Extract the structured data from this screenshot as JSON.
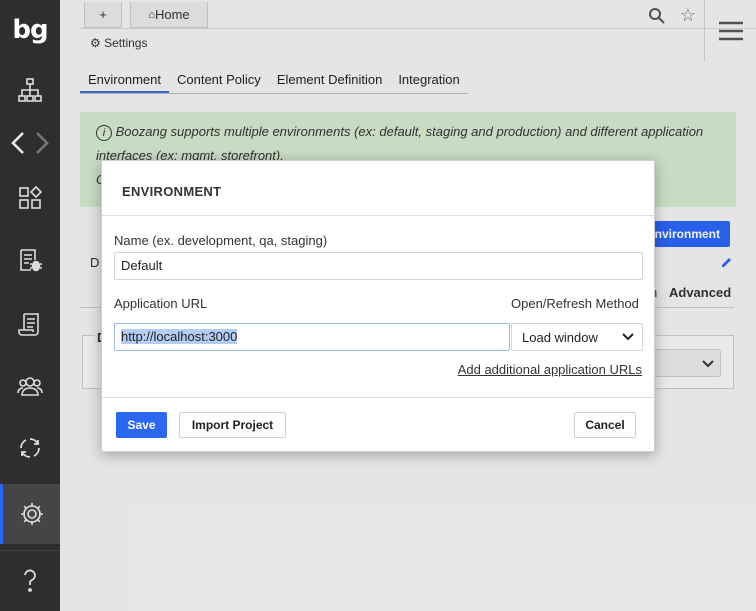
{
  "app": {
    "logo_text": "bg",
    "accent_color": "#2c66f5"
  },
  "sidebar": {
    "items": [
      {
        "icon": "sitemap-icon"
      },
      {
        "icon": "back-arrow-icon"
      },
      {
        "icon": "forward-arrow-icon"
      },
      {
        "icon": "modules-icon"
      },
      {
        "icon": "test-bug-icon"
      },
      {
        "icon": "script-icon"
      },
      {
        "icon": "users-icon"
      },
      {
        "icon": "cycle-icon"
      },
      {
        "icon": "gear-icon",
        "active": true
      },
      {
        "icon": "help-icon"
      }
    ]
  },
  "topbar": {
    "new_tab_label": "+",
    "home_tab_label": "Home",
    "breadcrumb": "Settings"
  },
  "tabs": [
    {
      "label": "Environment",
      "active": true
    },
    {
      "label": "Content Policy"
    },
    {
      "label": "Element Definition"
    },
    {
      "label": "Integration"
    }
  ],
  "info": {
    "text": "Boozang supports multiple environments (ex: default, staging and production) and different application interfaces (ex: mgmt, storefront).",
    "second_line_start": "C"
  },
  "background": {
    "add_env_button": "nvironment",
    "row_label": "D",
    "partial_label": "n",
    "advanced_label": "Advanced",
    "box_label": "D"
  },
  "modal": {
    "title": "ENVIRONMENT",
    "name_label": "Name (ex. development, qa, staging)",
    "name_value": "Default",
    "url_label": "Application URL",
    "url_value": "http://localhost:3000",
    "method_label": "Open/Refresh Method",
    "method_value": "Load window",
    "add_urls_link": "Add additional application URLs",
    "save_button": "Save",
    "import_button": "Import Project",
    "cancel_button": "Cancel"
  }
}
